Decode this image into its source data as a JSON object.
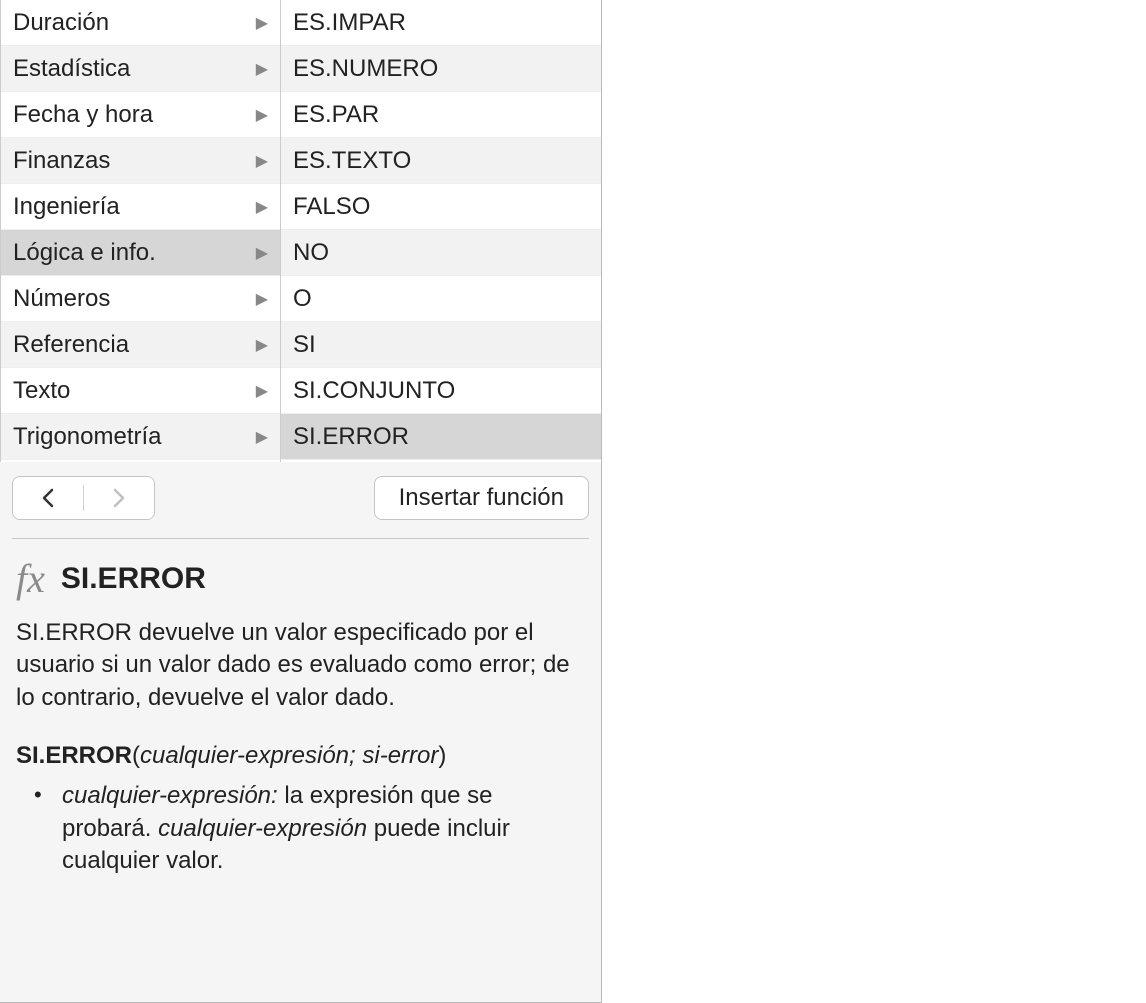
{
  "categories": [
    {
      "label": "Duración"
    },
    {
      "label": "Estadística"
    },
    {
      "label": "Fecha y hora"
    },
    {
      "label": "Finanzas"
    },
    {
      "label": "Ingeniería"
    },
    {
      "label": "Lógica e info.",
      "selected": true
    },
    {
      "label": "Números"
    },
    {
      "label": "Referencia"
    },
    {
      "label": "Texto"
    },
    {
      "label": "Trigonometría"
    }
  ],
  "functions": [
    {
      "label": "ES.IMPAR"
    },
    {
      "label": "ES.NUMERO"
    },
    {
      "label": "ES.PAR"
    },
    {
      "label": "ES.TEXTO"
    },
    {
      "label": "FALSO"
    },
    {
      "label": "NO"
    },
    {
      "label": "O"
    },
    {
      "label": "SI"
    },
    {
      "label": "SI.CONJUNTO"
    },
    {
      "label": "SI.ERROR",
      "selected": true
    }
  ],
  "insert_button": "Insertar función",
  "help": {
    "fx": "fx",
    "title": "SI.ERROR",
    "description": "SI.ERROR devuelve un valor especificado por el usuario si un valor dado es evaluado como error; de lo contrario, devuelve el valor dado.",
    "syntax_name": "SI.ERROR",
    "syntax_arg1": "cualquier-expresión",
    "syntax_sep": "; ",
    "syntax_arg2": "si-error",
    "param1_name": "cualquier-expresión:",
    "param1_text1": " la expresión que se probará. ",
    "param1_emph": "cualquier-expresión",
    "param1_text2": " puede incluir cualquier valor."
  }
}
